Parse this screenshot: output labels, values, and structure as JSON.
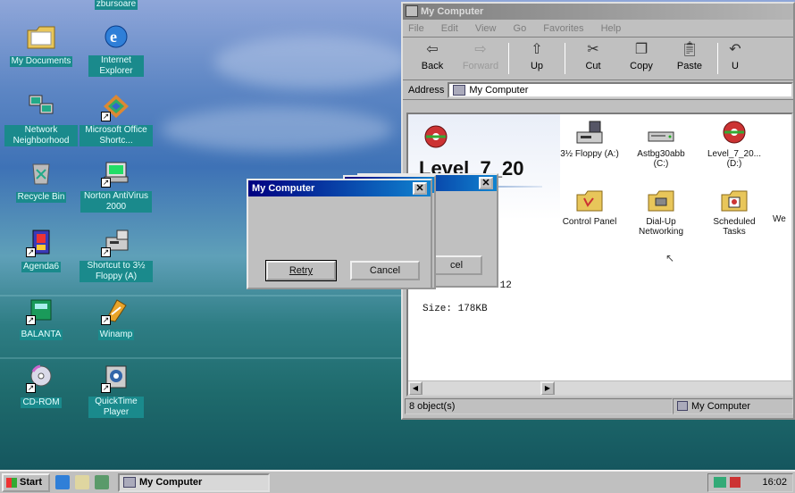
{
  "desktop": {
    "icons": [
      {
        "label": "My Documents",
        "icon": "folder-icon"
      },
      {
        "label": "Internet Explorer",
        "icon": "internet-explorer-icon"
      },
      {
        "label": "Network Neighborhood",
        "icon": "network-icon"
      },
      {
        "label": "Microsoft Office Shortc...",
        "icon": "office-icon"
      },
      {
        "label": "Recycle Bin",
        "icon": "recycle-bin-icon"
      },
      {
        "label": "Norton AntiVirus 2000",
        "icon": "norton-icon"
      },
      {
        "label": "Agenda6",
        "icon": "agenda-icon"
      },
      {
        "label": "Shortcut to 3½ Floppy (A)",
        "icon": "floppy-shortcut-icon"
      },
      {
        "label": "BALANTA",
        "icon": "balanta-icon"
      },
      {
        "label": "Winamp",
        "icon": "winamp-icon"
      },
      {
        "label": "CD-ROM",
        "icon": "cdrom-icon"
      },
      {
        "label": "QuickTime Player",
        "icon": "quicktime-icon"
      }
    ],
    "top_label": "zbursoare"
  },
  "explorer": {
    "title": "My Computer",
    "menu": [
      "File",
      "Edit",
      "View",
      "Go",
      "Favorites",
      "Help"
    ],
    "toolbar": {
      "back": "Back",
      "forward": "Forward",
      "up": "Up",
      "cut": "Cut",
      "copy": "Copy",
      "paste": "Paste",
      "undo": "U"
    },
    "address_label": "Address",
    "address_value": "My Computer",
    "panel_title": "Level_7_20",
    "panel_time": ":12",
    "panel_size": "Size: 178KB",
    "items": [
      {
        "label": "3½ Floppy (A:)",
        "icon": "floppy-drive-icon"
      },
      {
        "label": "Astbg30abb (C:)",
        "icon": "hard-drive-icon"
      },
      {
        "label": "Level_7_20... (D:)",
        "icon": "cd-drive-icon"
      },
      {
        "label": "Control Panel",
        "icon": "control-panel-icon"
      },
      {
        "label": "Dial-Up Networking",
        "icon": "dialup-icon"
      },
      {
        "label": "Scheduled Tasks",
        "icon": "scheduled-tasks-icon"
      },
      {
        "label": "We",
        "icon": "web-folder-icon"
      }
    ],
    "status_left": "8 object(s)",
    "status_right": "My Computer"
  },
  "dialog_front": {
    "title": "My Computer",
    "retry_label": "Retry",
    "cancel_label": "Cancel"
  },
  "dialog_back": {
    "cancel_partial": "cel"
  },
  "taskbar": {
    "start_label": "Start",
    "task_label": "My Computer",
    "clock": "16:02"
  }
}
